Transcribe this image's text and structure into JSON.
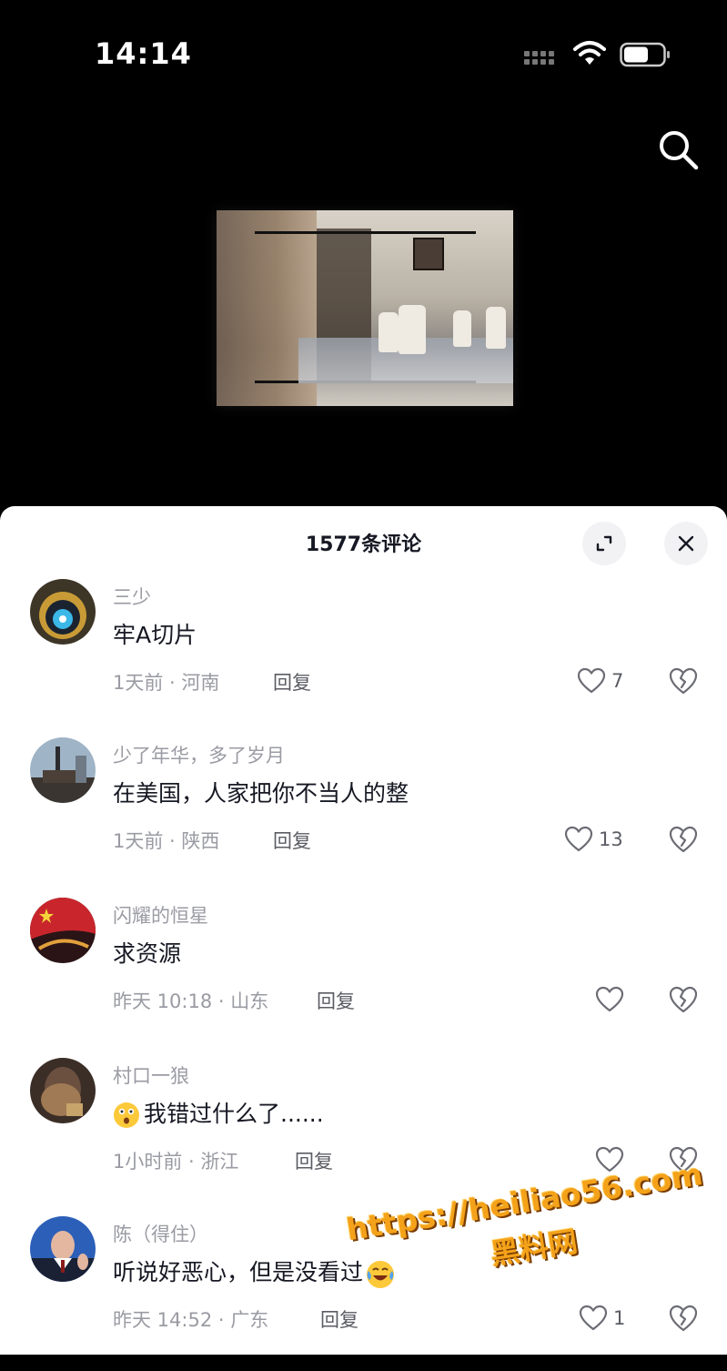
{
  "status_bar": {
    "time": "14:14"
  },
  "header": {
    "search_icon": "search-icon"
  },
  "video": {
    "description": ""
  },
  "comments_sheet": {
    "title": "1577条评论",
    "expand_icon": "expand-icon",
    "close_icon": "close-icon"
  },
  "comments": [
    {
      "username": "三少",
      "text": "牢A切片",
      "meta": "1天前 · 河南",
      "reply": "回复",
      "likes": "7"
    },
    {
      "username": "少了年华，多了岁月",
      "text": "在美国，人家把你不当人的整",
      "meta": "1天前 · 陕西",
      "reply": "回复",
      "likes": "13"
    },
    {
      "username": "闪耀的恒星",
      "text": "求资源",
      "meta": "昨天 10:18 · 山东",
      "reply": "回复",
      "likes": ""
    },
    {
      "username": "村口一狼",
      "text": "我错过什么了......",
      "meta": "1小时前 · 浙江",
      "reply": "回复",
      "likes": ""
    },
    {
      "username": "陈（得住）",
      "text": "听说好恶心，但是没看过",
      "meta": "昨天 14:52 · 广东",
      "reply": "回复",
      "likes": "1"
    }
  ],
  "watermark": {
    "url": "https://heiliao56.com",
    "name": "黑料网"
  },
  "colors": {
    "sheet_bg": "#ffffff",
    "text_primary": "#161823",
    "text_secondary": "#9a9ba3",
    "watermark": "#f4a21a"
  }
}
